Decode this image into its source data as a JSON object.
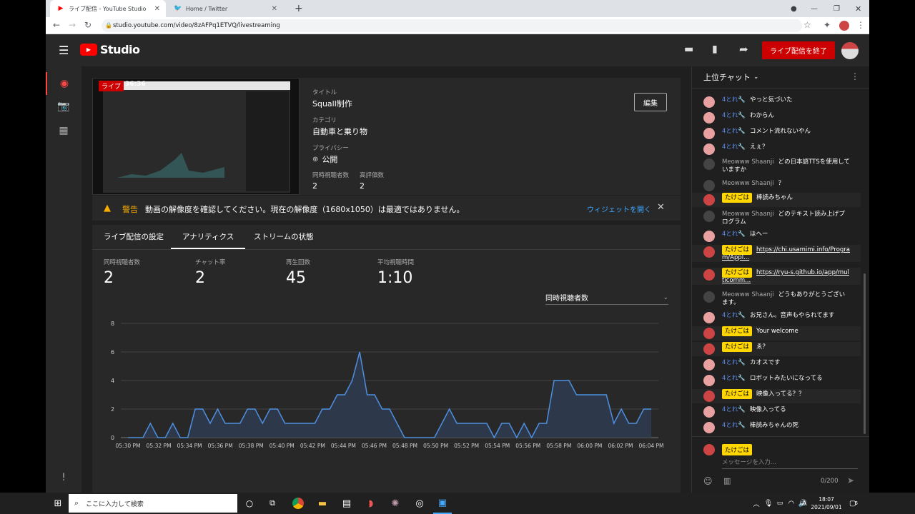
{
  "browser": {
    "tabs": [
      {
        "title": "ライブ配信 - YouTube Studio",
        "favicon": "youtube-icon",
        "active": true
      },
      {
        "title": "Home / Twitter",
        "favicon": "twitter-icon",
        "active": false
      }
    ],
    "url": "studio.youtube.com/video/8zAFPq1ETVQ/livestreaming"
  },
  "header": {
    "logo_text": "Studio",
    "end_stream_label": "ライブ配信を終了"
  },
  "stream": {
    "live_badge": "ライブ",
    "elapsed": "36:36",
    "title_label": "タイトル",
    "title": "Squall制作",
    "category_label": "カテゴリ",
    "category": "自動車と乗り物",
    "privacy_label": "プライバシー",
    "privacy": "公開",
    "concurrent_label": "同時視聴者数",
    "concurrent": "2",
    "likes_label": "高評価数",
    "likes": "2",
    "edit_label": "編集"
  },
  "warning": {
    "label": "警告",
    "text": "動画の解像度を確認してください。現在の解像度（1680x1050）は最適ではありません。",
    "link": "ウィジェットを開く"
  },
  "analytics": {
    "tabs": [
      "ライブ配信の設定",
      "アナリティクス",
      "ストリームの状態"
    ],
    "active_tab": 1,
    "stats": [
      {
        "label": "同時視聴者数",
        "value": "2"
      },
      {
        "label": "チャット率",
        "value": "2"
      },
      {
        "label": "再生回数",
        "value": "45"
      },
      {
        "label": "平均視聴時間",
        "value": "1:10"
      }
    ],
    "metric_select": "同時視聴者数"
  },
  "chart_data": {
    "type": "area",
    "title": "",
    "xlabel": "",
    "ylabel": "",
    "ylim": [
      0,
      8
    ],
    "yticks": [
      0,
      2,
      4,
      6,
      8
    ],
    "xtick_labels": [
      "05:30 PM",
      "05:32 PM",
      "05:34 PM",
      "05:36 PM",
      "05:38 PM",
      "05:40 PM",
      "05:42 PM",
      "05:44 PM",
      "05:46 PM",
      "05:48 PM",
      "05:50 PM",
      "05:52 PM",
      "05:54 PM",
      "05:56 PM",
      "05:58 PM",
      "06:00 PM",
      "06:02 PM",
      "06:04 PM"
    ],
    "grid": true,
    "color": "#4e8fe0",
    "series": [
      {
        "values": [
          0,
          0,
          0,
          1,
          0,
          0,
          1,
          0,
          0,
          2,
          2,
          1,
          2,
          1,
          1,
          1,
          2,
          2,
          1,
          2,
          2,
          1,
          1,
          1,
          1,
          1,
          2,
          2,
          3,
          3,
          4,
          6,
          3,
          3,
          2,
          2,
          1,
          0,
          0,
          0,
          0,
          0,
          1,
          2,
          1,
          1,
          1,
          1,
          1,
          0,
          1,
          1,
          0,
          1,
          0,
          1,
          1,
          4,
          4,
          4,
          3,
          3,
          3,
          3,
          3,
          1,
          2,
          1,
          1,
          2,
          2
        ]
      }
    ]
  },
  "chat": {
    "header": "上位チャット",
    "messages": [
      {
        "author": "4とれ🔧",
        "kind": "member",
        "text": "やっと気づいた",
        "avatar": "#e8a0a0"
      },
      {
        "author": "4とれ🔧",
        "kind": "member",
        "text": "わからん",
        "avatar": "#e8a0a0"
      },
      {
        "author": "4とれ🔧",
        "kind": "member",
        "text": "コメント流れないやん",
        "avatar": "#e8a0a0"
      },
      {
        "author": "4とれ🔧",
        "kind": "member",
        "text": "えぇ？",
        "avatar": "#e8a0a0"
      },
      {
        "author": "Meowww Shaanji",
        "kind": "plain",
        "text": "どの日本語TTSを使用していますか",
        "avatar": "#444"
      },
      {
        "author": "Meowww Shaanji",
        "kind": "plain",
        "text": "？",
        "avatar": "#444"
      },
      {
        "author": "たけごは",
        "kind": "owner",
        "text": "棒読みちゃん",
        "avatar": "#c44"
      },
      {
        "author": "Meowww Shaanji",
        "kind": "plain",
        "text": "どのテキスト読み上げプログラム",
        "avatar": "#444"
      },
      {
        "author": "4とれ🔧",
        "kind": "member",
        "text": "ほへー",
        "avatar": "#e8a0a0"
      },
      {
        "author": "たけごは",
        "kind": "owner",
        "text": "https://chi.usamimi.info/Program/Appl...",
        "link": true,
        "avatar": "#c44"
      },
      {
        "author": "たけごは",
        "kind": "owner",
        "text": "https://ryu-s.github.io/app/multicomm...",
        "link": true,
        "avatar": "#c44"
      },
      {
        "author": "Meowww Shaanji",
        "kind": "plain",
        "text": "どうもありがとうございます。",
        "avatar": "#444"
      },
      {
        "author": "4とれ🔧",
        "kind": "member",
        "text": "お兄さん。音声もやられてます",
        "avatar": "#e8a0a0"
      },
      {
        "author": "たけごは",
        "kind": "owner",
        "text": "Your welcome",
        "avatar": "#c44"
      },
      {
        "author": "たけごは",
        "kind": "owner",
        "text": "ゑ？",
        "avatar": "#c44"
      },
      {
        "author": "4とれ🔧",
        "kind": "member",
        "text": "カオスです",
        "avatar": "#e8a0a0"
      },
      {
        "author": "4とれ🔧",
        "kind": "member",
        "text": "ロボットみたいになってる",
        "avatar": "#e8a0a0"
      },
      {
        "author": "たけごは",
        "kind": "owner",
        "text": "映像入ってる？？",
        "avatar": "#c44"
      },
      {
        "author": "4とれ🔧",
        "kind": "member",
        "text": "映像入ってる",
        "avatar": "#e8a0a0"
      },
      {
        "author": "4とれ🔧",
        "kind": "member",
        "text": "棒読みちゃんの死",
        "avatar": "#e8a0a0"
      }
    ],
    "input_author": "たけごは",
    "input_placeholder": "メッセージを入力...",
    "counter": "0/200"
  },
  "taskbar": {
    "search_placeholder": "ここに入力して検索",
    "time": "18:07",
    "date": "2021/09/01",
    "ime": "A",
    "notif_count": "6"
  }
}
